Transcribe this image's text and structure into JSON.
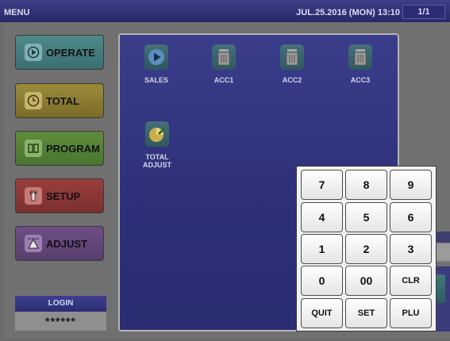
{
  "topbar": {
    "title": "MENU",
    "datetime": "JUL.25.2016 (MON)  13:10",
    "page": "1/1"
  },
  "modes": [
    {
      "label": "OPERATE",
      "icon": "play-circle-icon"
    },
    {
      "label": "TOTAL",
      "icon": "clock-icon"
    },
    {
      "label": "PROGRAM",
      "icon": "book-icon"
    },
    {
      "label": "SETUP",
      "icon": "wrench-icon"
    },
    {
      "label": "ADJUST",
      "icon": "ruler-triangle-icon"
    }
  ],
  "login": {
    "label": "LOGIN",
    "password_mask": "******"
  },
  "functions": [
    {
      "label": "SALES",
      "icon": "play-icon"
    },
    {
      "label": "ACC1",
      "icon": "trash-icon"
    },
    {
      "label": "ACC2",
      "icon": "trash-icon"
    },
    {
      "label": "ACC3",
      "icon": "trash-icon"
    },
    {
      "label_line1": "TOTAL",
      "label_line2": "ADJUST",
      "icon": "pie-chart-pencil-icon"
    }
  ],
  "keypad": {
    "keys": [
      "7",
      "8",
      "9",
      "4",
      "5",
      "6",
      "1",
      "2",
      "3",
      "0",
      "00",
      "CLR",
      "QUIT",
      "SET",
      "PLU"
    ]
  },
  "colors": {
    "topbar": "#2e3178",
    "main_panel": "#2d3078",
    "operate": "#4f8a8a",
    "total": "#9b8c3a",
    "program": "#5f8c3b",
    "setup": "#9a3e3e",
    "adjust": "#6f4e86"
  }
}
